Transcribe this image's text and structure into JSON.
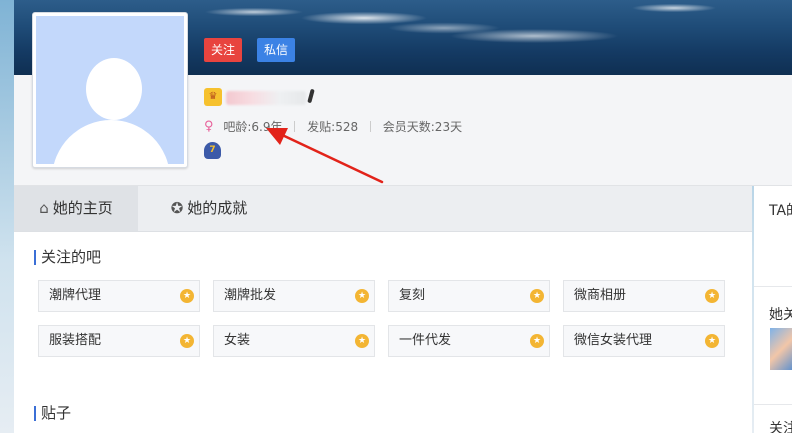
{
  "profile": {
    "follow_label": "关注",
    "message_label": "私信",
    "stats": {
      "bar_age": "吧龄:6.9年",
      "posts": "发贴:528",
      "member_days": "会员天数:23天"
    }
  },
  "tabs": [
    {
      "label": "她的主页",
      "icon": "home-icon"
    },
    {
      "label": "她的成就",
      "icon": "medal-icon"
    }
  ],
  "followed_bars": {
    "title": "关注的吧",
    "items": [
      {
        "label": "潮牌代理"
      },
      {
        "label": "潮牌批发"
      },
      {
        "label": "复刻"
      },
      {
        "label": "微商相册"
      },
      {
        "label": "服装搭配"
      },
      {
        "label": "女装"
      },
      {
        "label": "一件代发"
      },
      {
        "label": "微信女装代理"
      }
    ]
  },
  "posts": {
    "title": "贴子"
  },
  "right_panel": {
    "ta_label": "TA的",
    "her_follow_label": "她关",
    "follow_label": "关注"
  },
  "colors": {
    "follow_button": "#e8443f",
    "message_button": "#3b82e5",
    "annotation_arrow": "#e2231a",
    "section_accent": "#3b6fd6"
  }
}
